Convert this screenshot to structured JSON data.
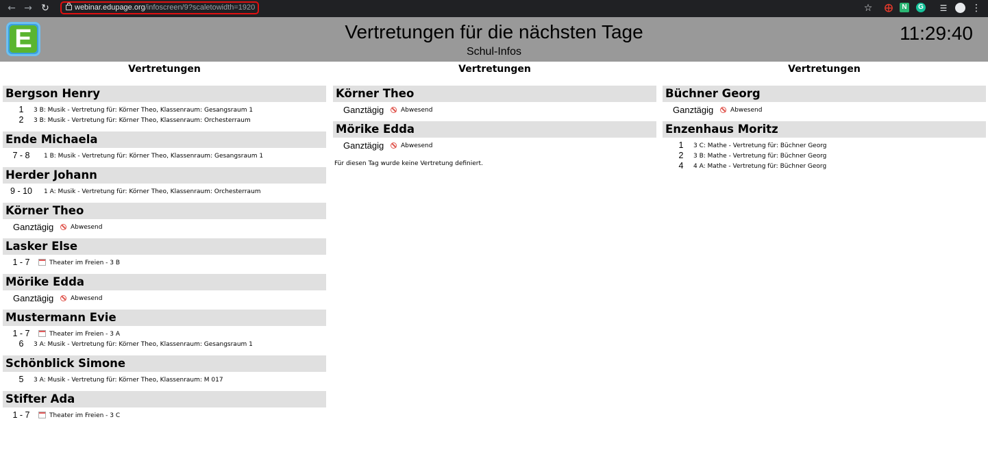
{
  "browser": {
    "url_host": "webinar.edupage.org",
    "url_path": "/infoscreen/9?scaletowidth=1920"
  },
  "header": {
    "logo_letter": "E",
    "title": "Vertretungen für die nächsten Tage",
    "subtitle": "Schul-Infos",
    "clock": "11:29:40"
  },
  "columns": [
    {
      "heading": "Vertretungen",
      "people": [
        {
          "name": "Bergson Henry",
          "entries": [
            {
              "period": "1",
              "text": "3 B: Musik - Vertretung für: Körner Theo, Klassenraum: Gesangsraum 1"
            },
            {
              "period": "2",
              "text": "3 B: Musik - Vertretung für: Körner Theo, Klassenraum: Orchesterraum"
            }
          ]
        },
        {
          "name": "Ende Michaela",
          "entries": [
            {
              "period": "7 - 8",
              "text": "1 B: Musik - Vertretung für: Körner Theo, Klassenraum: Gesangsraum 1"
            }
          ]
        },
        {
          "name": "Herder Johann",
          "entries": [
            {
              "period": "9 - 10",
              "text": "1 A: Musik - Vertretung für: Körner Theo, Klassenraum: Orchesterraum"
            }
          ]
        },
        {
          "name": "Körner Theo",
          "entries": [
            {
              "allday": "Ganztägig",
              "status": "Abwesend"
            }
          ]
        },
        {
          "name": "Lasker Else",
          "entries": [
            {
              "period": "1 - 7",
              "event": "Theater im Freien - 3 B"
            }
          ]
        },
        {
          "name": "Mörike Edda",
          "entries": [
            {
              "allday": "Ganztägig",
              "status": "Abwesend"
            }
          ]
        },
        {
          "name": "Mustermann Evie",
          "entries": [
            {
              "period": "1 - 7",
              "event": "Theater im Freien - 3 A"
            },
            {
              "period": "6",
              "text": "3 A: Musik - Vertretung für: Körner Theo, Klassenraum: Gesangsraum 1"
            }
          ]
        },
        {
          "name": "Schönblick Simone",
          "entries": [
            {
              "period": "5",
              "text": "3 A: Musik - Vertretung für: Körner Theo, Klassenraum: M 017"
            }
          ]
        },
        {
          "name": "Stifter Ada",
          "entries": [
            {
              "period": "1 - 7",
              "event": "Theater im Freien - 3 C"
            }
          ]
        }
      ]
    },
    {
      "heading": "Vertretungen",
      "people": [
        {
          "name": "Körner Theo",
          "entries": [
            {
              "allday": "Ganztägig",
              "status": "Abwesend"
            }
          ]
        },
        {
          "name": "Mörike Edda",
          "entries": [
            {
              "allday": "Ganztägig",
              "status": "Abwesend"
            }
          ]
        }
      ],
      "note": "Für diesen Tag wurde keine Vertretung definiert."
    },
    {
      "heading": "Vertretungen",
      "people": [
        {
          "name": "Büchner Georg",
          "entries": [
            {
              "allday": "Ganztägig",
              "status": "Abwesend"
            }
          ]
        },
        {
          "name": "Enzenhaus Moritz",
          "entries": [
            {
              "period": "1",
              "text": "3 C: Mathe - Vertretung für: Büchner Georg"
            },
            {
              "period": "2",
              "text": "3 B: Mathe - Vertretung für: Büchner Georg"
            },
            {
              "period": "4",
              "text": "4 A: Mathe - Vertretung für: Büchner Georg"
            }
          ]
        }
      ]
    }
  ]
}
